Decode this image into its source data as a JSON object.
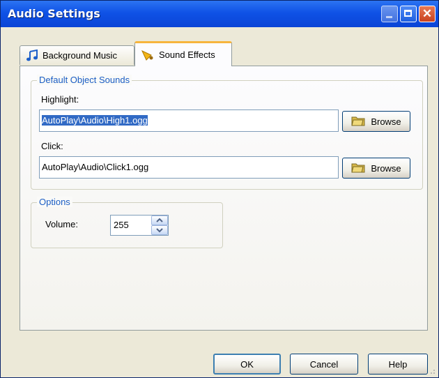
{
  "window": {
    "title": "Audio Settings"
  },
  "tabs": [
    {
      "label": "Background Music",
      "icon": "music-note-icon"
    },
    {
      "label": "Sound Effects",
      "icon": "horn-icon"
    }
  ],
  "default_sounds": {
    "title": "Default Object Sounds",
    "highlight_label": "Highlight:",
    "highlight_value": "AutoPlay\\Audio\\High1.ogg",
    "click_label": "Click:",
    "click_value": "AutoPlay\\Audio\\Click1.ogg",
    "browse_label": "Browse"
  },
  "options": {
    "title": "Options",
    "volume_label": "Volume:",
    "volume_value": "255"
  },
  "buttons": {
    "ok": "OK",
    "cancel": "Cancel",
    "help": "Help"
  },
  "colors": {
    "titlebar": "#0f52e6",
    "group_title": "#1b5dc4",
    "selection": "#316ac5",
    "active_tab_accent": "#f7b53d"
  }
}
